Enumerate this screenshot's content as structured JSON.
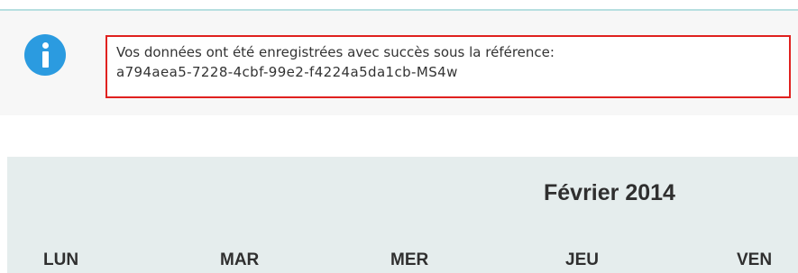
{
  "notice": {
    "line1": "Vos données ont été enregistrées avec succès sous la référence:",
    "line2": "a794aea5-7228-4cbf-99e2-f4224a5da1cb-MS4w",
    "icon": "info-icon",
    "icon_color": "#2b9be0",
    "border_color": "#e0211f"
  },
  "calendar": {
    "title": "Février 2014",
    "days": [
      "LUN",
      "MAR",
      "MER",
      "JEU",
      "VEN"
    ]
  }
}
